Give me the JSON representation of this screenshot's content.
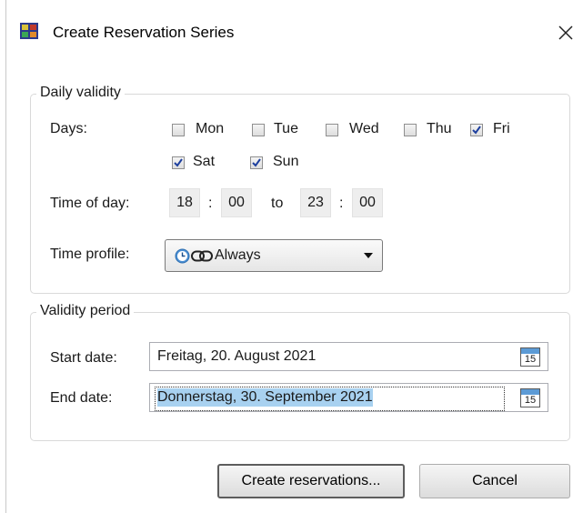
{
  "window": {
    "title": "Create Reservation Series"
  },
  "daily": {
    "legend": "Daily validity",
    "days_label": "Days:",
    "days": [
      {
        "label": "Mon",
        "checked": false
      },
      {
        "label": "Tue",
        "checked": false
      },
      {
        "label": "Wed",
        "checked": false
      },
      {
        "label": "Thu",
        "checked": false
      },
      {
        "label": "Fri",
        "checked": true
      },
      {
        "label": "Sat",
        "checked": true
      },
      {
        "label": "Sun",
        "checked": true
      }
    ],
    "time_label": "Time of day:",
    "from_hour": "18",
    "from_minute": "00",
    "to_label": "to",
    "to_hour": "23",
    "to_minute": "00",
    "colon": ":",
    "profile_label": "Time profile:",
    "profile_value": "Always"
  },
  "period": {
    "legend": "Validity period",
    "start_label": "Start date:",
    "start_value": "Freitag, 20. August 2021",
    "end_label": "End date:",
    "end_value": "Donnerstag, 30. September 2021",
    "calendar_day": "15"
  },
  "buttons": {
    "create": "Create reservations...",
    "cancel": "Cancel"
  },
  "colors": {
    "selection": "#a8d1f0",
    "calendar_header": "#5c9bd6",
    "check": "#1d3f9e"
  }
}
